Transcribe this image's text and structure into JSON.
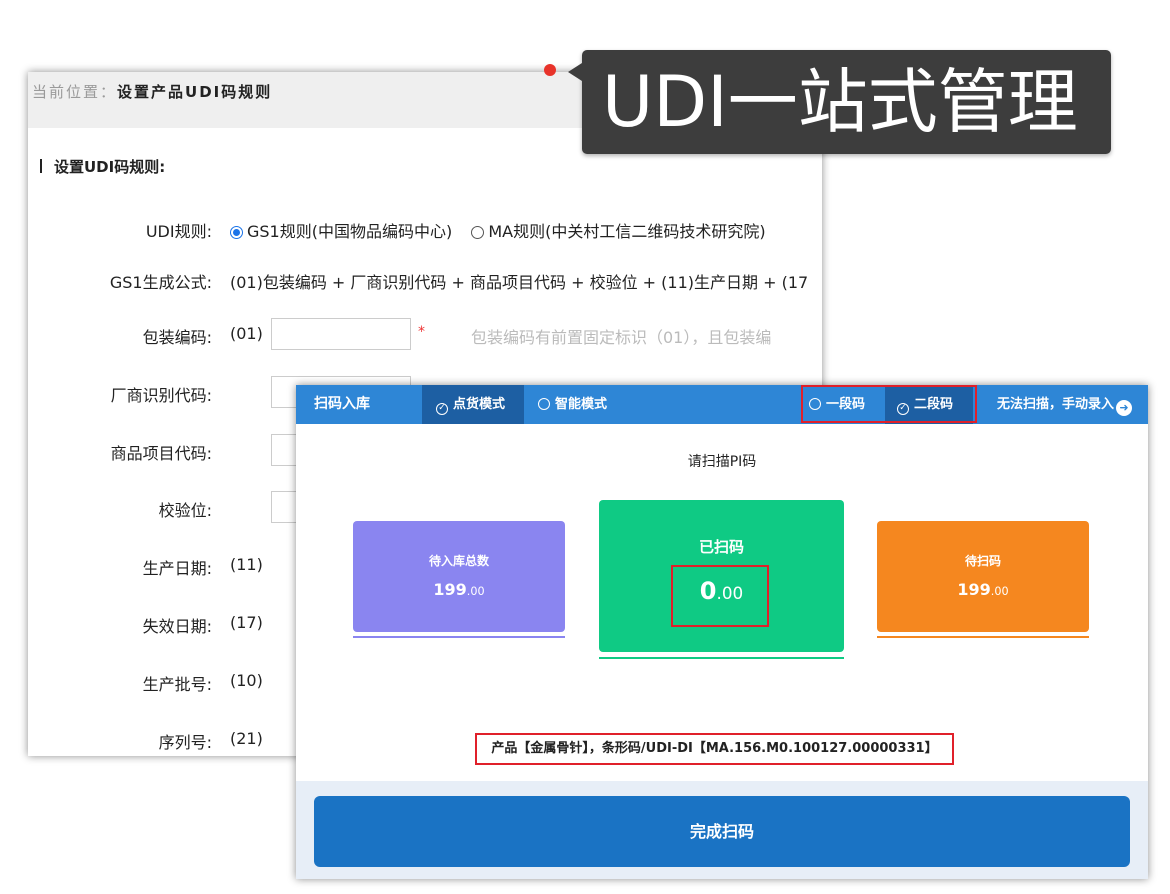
{
  "back_window": {
    "breadcrumb_prefix": "当前位置：",
    "breadcrumb_current": "设置产品UDI码规则",
    "section_title": "设置UDI码规则:",
    "udi_rule_label": "UDI规则:",
    "udi_rule_option1": "GS1规则(中国物品编码中心)",
    "udi_rule_option2": "MA规则(中关村工信二维码技术研究院)",
    "formula_label": "GS1生成公式:",
    "formula_value": "(01)包装编码 + 厂商识别代码 + 商品项目代码 + 校验位 + (11)生产日期 + (17",
    "pkg_label": "包装编码:",
    "pkg_prefix": "(01)",
    "pkg_required": "*",
    "pkg_hint": "包装编码有前置固定标识（01），且包装编",
    "mfr_label": "厂商识别代码:",
    "item_label": "商品项目代码:",
    "check_label": "校验位:",
    "prod_date_label": "生产日期:",
    "prod_date_prefix": "(11)",
    "exp_date_label": "失效日期:",
    "exp_date_prefix": "(17)",
    "batch_label": "生产批号:",
    "batch_prefix": "(10)",
    "serial_label": "序列号:",
    "serial_prefix": "(21)"
  },
  "callout": {
    "text": "UDI一站式管理"
  },
  "front_window": {
    "title": "扫码入库",
    "mode_count": "点货模式",
    "mode_smart": "智能模式",
    "code_one_segment": "一段码",
    "code_two_segment": "二段码",
    "manual_entry": "无法扫描，手动录入",
    "prompt": "请扫描PI码",
    "cards": {
      "pending_total_label": "待入库总数",
      "pending_total_int": "199",
      "pending_total_dec": ".00",
      "scanned_label": "已扫码",
      "scanned_int": "0",
      "scanned_dec": ".00",
      "to_scan_label": "待扫码",
      "to_scan_int": "199",
      "to_scan_dec": ".00"
    },
    "product_line": "产品【金属骨针】，条形码/UDI-DI【MA.156.M0.100127.00000331】",
    "done_button": "完成扫码"
  },
  "colors": {
    "topbar": "#2e86d6",
    "card_purple": "#8a85f0",
    "card_green": "#0fca84",
    "card_orange": "#f5871f",
    "highlight_red": "#e0202a",
    "done_button": "#1a73c4"
  }
}
